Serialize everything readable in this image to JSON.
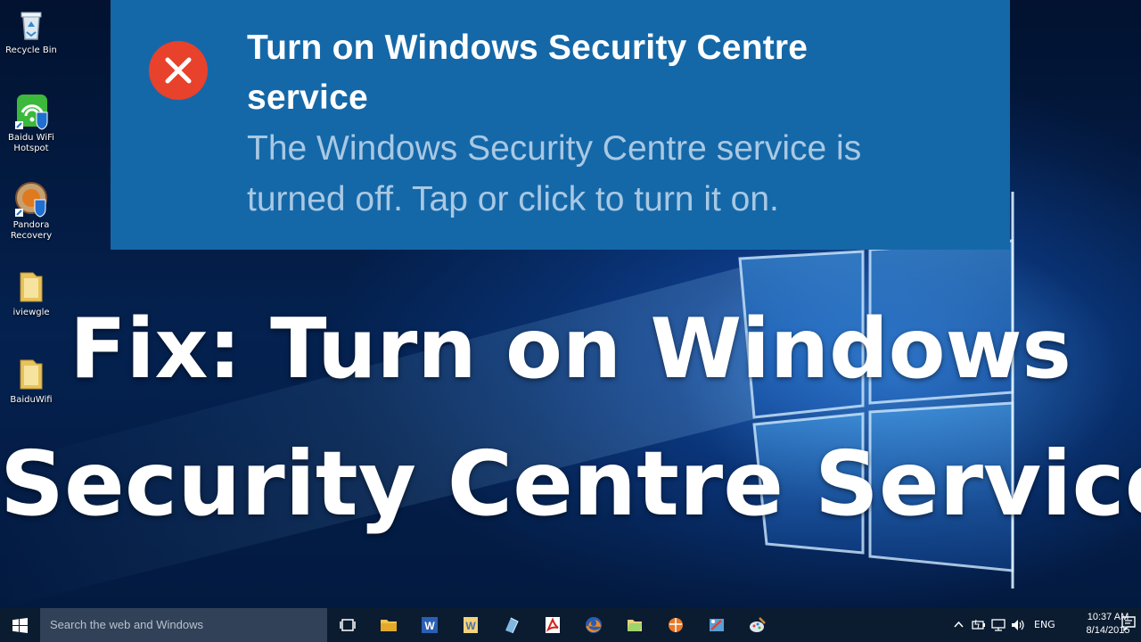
{
  "desktop": {
    "icons": [
      {
        "label": "Recycle Bin",
        "icon": "recycle-bin-icon"
      },
      {
        "label": "Baidu WiFi Hotspot",
        "icon": "wifi-hotspot-icon"
      },
      {
        "label": "Pandora Recovery",
        "icon": "pandora-recovery-icon"
      },
      {
        "label": "iviewgle",
        "icon": "folder-icon"
      },
      {
        "label": "BaiduWifi",
        "icon": "folder-icon"
      }
    ]
  },
  "toast": {
    "title": "Turn on Windows Security Centre service",
    "message": "The Windows Security Centre service is turned off. Tap or click to turn it on.",
    "icon": "error-icon",
    "background": "#1468a8",
    "error_color": "#e8412c"
  },
  "overlay": {
    "line1": "Fix: Turn on Windows",
    "line2": "Security Centre Service"
  },
  "taskbar": {
    "search_placeholder": "Search the web and Windows",
    "apps": [
      "task-view-icon",
      "file-explorer-icon",
      "word-icon",
      "wordpad-icon",
      "app-icon",
      "pdf-reader-icon",
      "firefox-icon",
      "folder-app-icon",
      "media-player-icon",
      "tool-icon",
      "paint-icon"
    ],
    "tray": {
      "language": "ENG",
      "time": "10:37 AM",
      "date": "8/14/2015"
    }
  }
}
